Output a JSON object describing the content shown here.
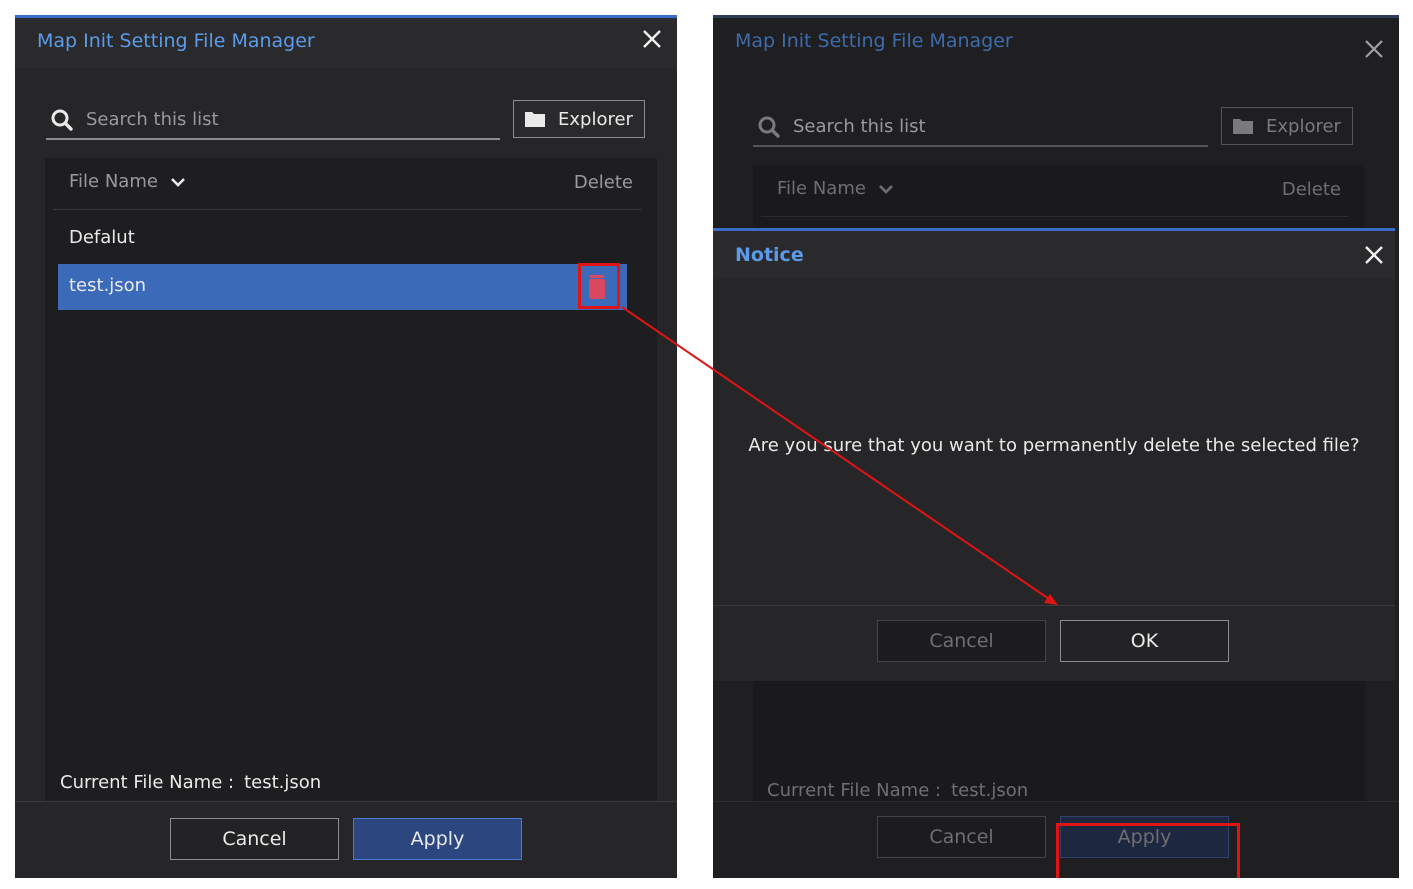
{
  "left_dialog": {
    "title": "Map Init Setting File Manager",
    "search_placeholder": "Search this list",
    "explorer_label": "Explorer",
    "col_file_name": "File Name",
    "col_delete": "Delete",
    "rows": [
      "Defalut",
      "test.json"
    ],
    "current_file_label": "Current File Name :",
    "current_file_value": "test.json",
    "cancel_label": "Cancel",
    "apply_label": "Apply"
  },
  "right_dialog": {
    "title": "Map Init Setting File Manager",
    "search_placeholder": "Search this list",
    "explorer_label": "Explorer",
    "col_file_name": "File Name",
    "col_delete": "Delete",
    "current_file_label": "Current File Name :",
    "current_file_value": "test.json",
    "cancel_label": "Cancel",
    "apply_label": "Apply"
  },
  "notice": {
    "title": "Notice",
    "message": "Are you sure that you want to permanently delete the selected file?",
    "cancel_label": "Cancel",
    "ok_label": "OK"
  },
  "colors": {
    "accent": "#3a6cc9",
    "title_blue": "#5b9bea",
    "selected_row": "#3b6ab8",
    "trash_red": "#d9485f",
    "annotation_red": "#e01414"
  },
  "icons": [
    "search-icon",
    "folder-icon",
    "close-icon",
    "chevron-down-icon",
    "trash-icon"
  ]
}
